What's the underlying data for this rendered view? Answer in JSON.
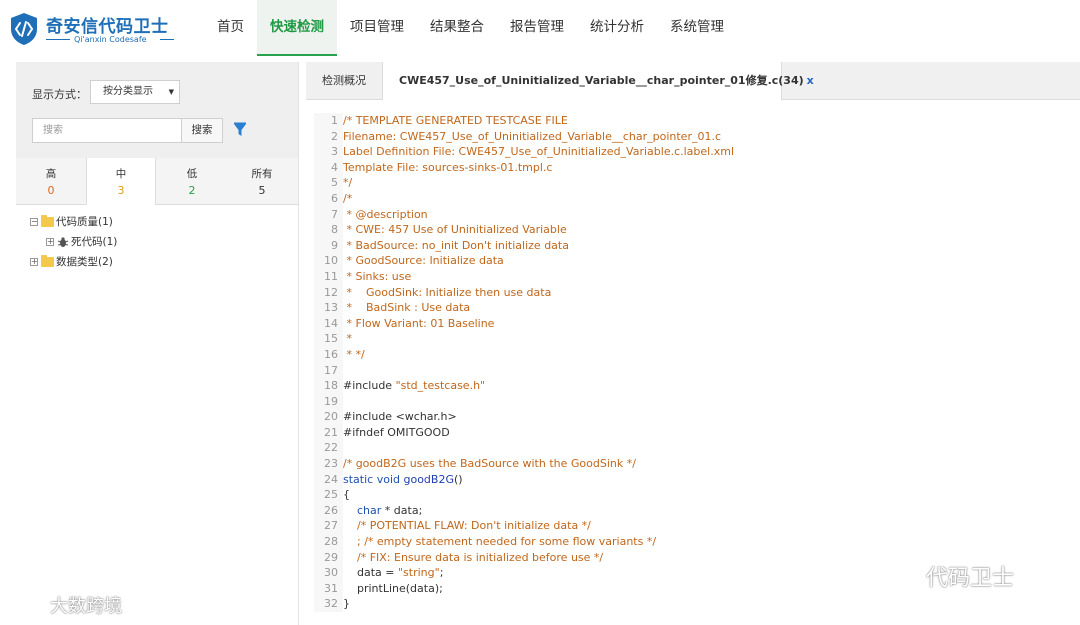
{
  "brand": {
    "name_cn": "奇安信代码卫士",
    "name_en": "Qi'anxin Codesafe",
    "color": "#1e6fb7"
  },
  "nav": {
    "items": [
      {
        "label": "首页"
      },
      {
        "label": "快速检测"
      },
      {
        "label": "项目管理"
      },
      {
        "label": "结果整合"
      },
      {
        "label": "报告管理"
      },
      {
        "label": "统计分析"
      },
      {
        "label": "系统管理"
      }
    ],
    "active_index": 1,
    "active_color": "#2aa24d"
  },
  "sidebar": {
    "display_label": "显示方式：",
    "display_value": "按分类显示",
    "search_placeholder": "搜索",
    "search_button": "搜索",
    "filter_icon": "funnel-icon",
    "severity_tabs": [
      {
        "name": "高",
        "count": "0",
        "color": "#e0691a"
      },
      {
        "name": "中",
        "count": "3",
        "color": "#e0a01a"
      },
      {
        "name": "低",
        "count": "2",
        "color": "#2aa24d"
      },
      {
        "name": "所有",
        "count": "5",
        "color": "#333333"
      }
    ],
    "severity_active_index": 1,
    "tree": [
      {
        "label": "代码质量(1)",
        "expander": "⊟"
      },
      {
        "label": "死代码(1)",
        "expander": "⊞"
      },
      {
        "label": "数据类型(2)",
        "expander": "⊞"
      }
    ]
  },
  "editor": {
    "tabs": [
      {
        "label": "检测概况"
      },
      {
        "label": "CWE457_Use_of_Uninitialized_Variable__char_pointer_01修复.c(34)",
        "close": "x"
      }
    ],
    "active_tab_index": 1,
    "lines": [
      "/* TEMPLATE GENERATED TESTCASE FILE",
      "Filename: CWE457_Use_of_Uninitialized_Variable__char_pointer_01.c",
      "Label Definition File: CWE457_Use_of_Uninitialized_Variable.c.label.xml",
      "Template File: sources-sinks-01.tmpl.c",
      "*/",
      "/*",
      " * @description",
      " * CWE: 457 Use of Uninitialized Variable",
      " * BadSource: no_init Don't initialize data",
      " * GoodSource: Initialize data",
      " * Sinks: use",
      " *    GoodSink: Initialize then use data",
      " *    BadSink : Use data",
      " * Flow Variant: 01 Baseline",
      " *",
      " * */",
      "",
      "#include \"std_testcase.h\"",
      "",
      "#include <wchar.h>",
      "#ifndef OMITGOOD",
      "",
      "/* goodB2G uses the BadSource with the GoodSink */",
      "static void goodB2G()",
      "{",
      "    char * data;",
      "    /* POTENTIAL FLAW: Don't initialize data */",
      "    ; /* empty statement needed for some flow variants */",
      "    /* FIX: Ensure data is initialized before use */",
      "    data = \"string\";",
      "    printLine(data);",
      "}"
    ]
  },
  "watermarks": {
    "right": "代码卫士",
    "left": "大数跨境"
  }
}
